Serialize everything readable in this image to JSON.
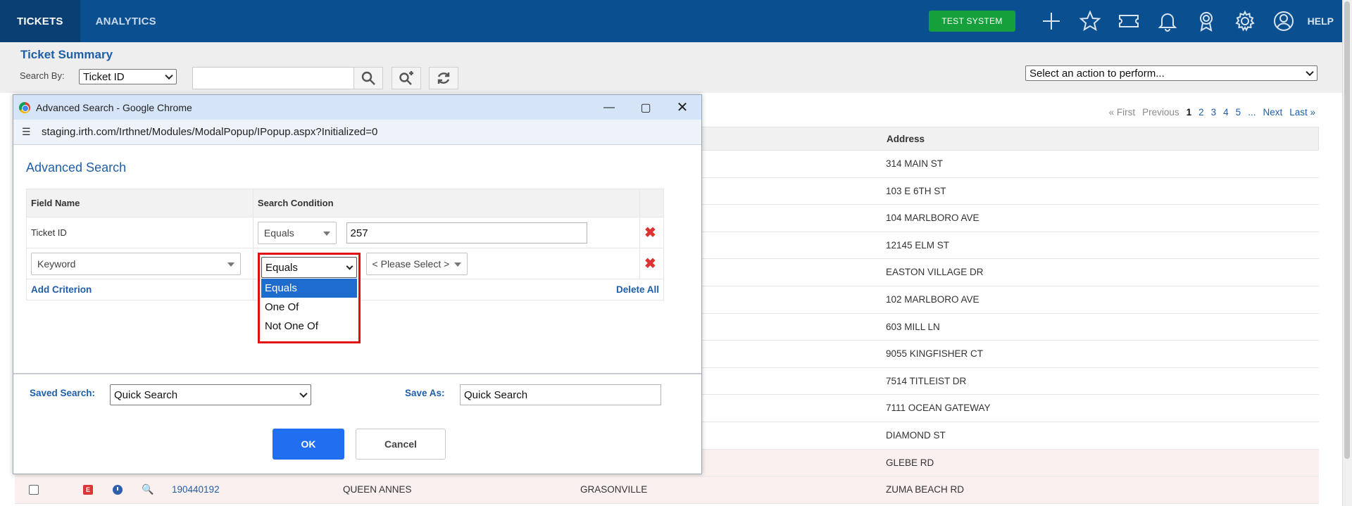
{
  "nav": {
    "tabs": [
      {
        "label": "TICKETS"
      },
      {
        "label": "ANALYTICS"
      }
    ],
    "test_badge": "TEST SYSTEM",
    "help": "HELP"
  },
  "header": {
    "title": "Ticket Summary",
    "search_by_label": "Search By:",
    "search_by_value": "Ticket ID",
    "search_input_value": "",
    "action_select": "Select an action to perform..."
  },
  "pager": {
    "first": "« First",
    "previous": "Previous",
    "pages": [
      "1",
      "2",
      "3",
      "4",
      "5"
    ],
    "ellipsis": "...",
    "next": "Next",
    "last": "Last »"
  },
  "table": {
    "address_header": "Address",
    "addresses": [
      "314 MAIN ST",
      "103 E 6TH ST",
      "104 MARLBORO AVE",
      "12145 ELM ST",
      "EASTON VILLAGE DR",
      "102 MARLBORO AVE",
      "603 MILL LN",
      "9055 KINGFISHER CT",
      "7514 TITLEIST DR",
      "7111 OCEAN GATEWAY",
      "DIAMOND ST",
      "GLEBE RD"
    ],
    "last_row": {
      "badge": "E",
      "ticket": "190440192",
      "county": "QUEEN ANNES",
      "city": "GRASONVILLE",
      "address": "ZUMA BEACH RD"
    }
  },
  "modal": {
    "window_title": "Advanced Search - Google Chrome",
    "url": "staging.irth.com/Irthnet/Modules/ModalPopup/IPopup.aspx?Initialized=0",
    "heading": "Advanced Search",
    "col_field": "Field Name",
    "col_condition": "Search Condition",
    "row1": {
      "field": "Ticket ID",
      "condition": "Equals",
      "value": "257"
    },
    "row2": {
      "field": "Keyword",
      "condition": "Equals",
      "value_select": "< Please Select >"
    },
    "dropdown_options": [
      "Equals",
      "One Of",
      "Not One Of"
    ],
    "add_criterion": "Add Criterion",
    "delete_all": "Delete All",
    "saved_search_label": "Saved Search:",
    "saved_search_value": "Quick Search",
    "save_as_label": "Save As:",
    "save_as_value": "Quick Search",
    "ok": "OK",
    "cancel": "Cancel"
  },
  "colors": {
    "nav_bg": "#0a4f8f",
    "accent": "#1f5ea8",
    "badge_green": "#15a03b",
    "highlight_red": "#e01010",
    "ok_blue": "#1f6ff0"
  }
}
